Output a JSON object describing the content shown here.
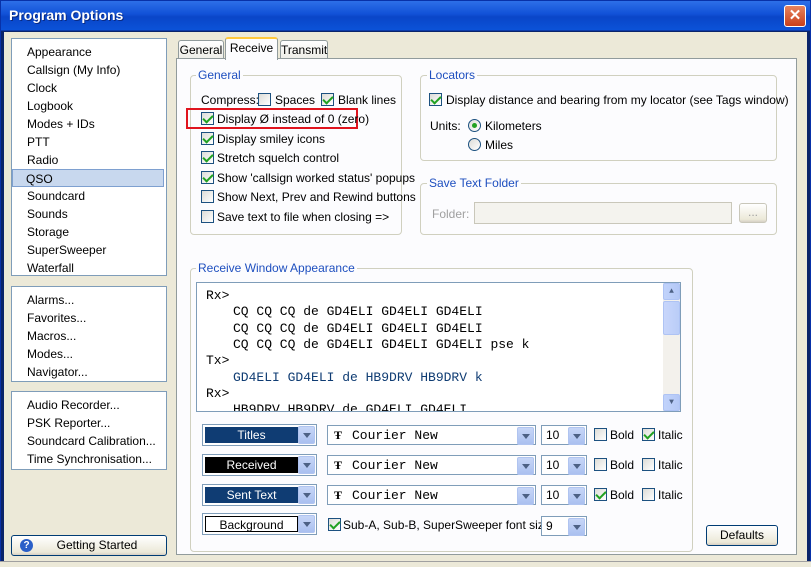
{
  "window": {
    "title": "Program Options"
  },
  "nav": {
    "group1": [
      "Appearance",
      "Callsign (My Info)",
      "Clock",
      "Logbook",
      "Modes + IDs",
      "PTT",
      "Radio",
      "QSO",
      "Soundcard",
      "Sounds",
      "Storage",
      "SuperSweeper",
      "Waterfall"
    ],
    "selected": "QSO",
    "group2": [
      "Alarms...",
      "Favorites...",
      "Macros...",
      "Modes...",
      "Navigator..."
    ],
    "group3": [
      "Audio Recorder...",
      "PSK Reporter...",
      "Soundcard Calibration...",
      "Time Synchronisation..."
    ],
    "getting_started": "Getting Started"
  },
  "tabs": [
    "General",
    "Receive",
    "Transmit"
  ],
  "active_tab": "Receive",
  "general": {
    "title": "General",
    "compress_label": "Compress:",
    "spaces": {
      "label": "Spaces",
      "checked": false
    },
    "blank_lines": {
      "label": "Blank lines",
      "checked": true
    },
    "options": [
      {
        "label": "Display Ø instead of 0 (zero)",
        "checked": true
      },
      {
        "label": "Display smiley icons",
        "checked": true
      },
      {
        "label": "Stretch squelch control",
        "checked": true
      },
      {
        "label": "Show 'callsign worked status' popups",
        "checked": true
      },
      {
        "label": "Show Next, Prev and Rewind buttons",
        "checked": false
      },
      {
        "label": "Save text to file when closing =>",
        "checked": false
      }
    ]
  },
  "locators": {
    "title": "Locators",
    "display_distance": {
      "label": "Display distance and bearing from my locator (see Tags window)",
      "checked": true
    },
    "units_label": "Units:",
    "units": [
      {
        "label": "Kilometers",
        "selected": true
      },
      {
        "label": "Miles",
        "selected": false
      }
    ]
  },
  "save_text_folder": {
    "title": "Save Text Folder",
    "folder_label": "Folder:",
    "folder_value": "",
    "browse_label": "..."
  },
  "appearance": {
    "title": "Receive Window Appearance",
    "preview_lines": [
      {
        "text": "Rx>",
        "indent": false,
        "color": "#000000"
      },
      {
        "text": "CQ CQ CQ de GD4ELI GD4ELI GD4ELI",
        "indent": true,
        "color": "#000000"
      },
      {
        "text": "CQ CQ CQ de GD4ELI GD4ELI GD4ELI",
        "indent": true,
        "color": "#000000"
      },
      {
        "text": "CQ CQ CQ de GD4ELI GD4ELI GD4ELI pse k",
        "indent": true,
        "color": "#000000"
      },
      {
        "text": "Tx>",
        "indent": false,
        "color": "#000000"
      },
      {
        "text": "GD4ELI GD4ELI de HB9DRV HB9DRV k",
        "indent": true,
        "color": "#0f3c73"
      },
      {
        "text": "Rx>",
        "indent": false,
        "color": "#000000"
      },
      {
        "text": "HB9DRV HB9DRV de GD4ELI GD4ELI",
        "indent": true,
        "color": "#000000"
      }
    ],
    "rows": [
      {
        "name": "Titles",
        "bg": "#0f3c73",
        "font": "Courier New",
        "size": "10",
        "bold": false,
        "italic": true,
        "bold_label": "Bold",
        "italic_label": "Italic"
      },
      {
        "name": "Received",
        "bg": "#000000",
        "font": "Courier New",
        "size": "10",
        "bold": false,
        "italic": false,
        "bold_label": "Bold",
        "italic_label": "Italic"
      },
      {
        "name": "Sent Text",
        "bg": "#0f3c73",
        "font": "Courier New",
        "size": "10",
        "bold": true,
        "italic": false,
        "bold_label": "Bold",
        "italic_label": "Italic"
      }
    ],
    "background_label": "Background",
    "sub_font": {
      "label": "Sub-A, Sub-B, SuperSweeper font size",
      "checked": true,
      "size": "9"
    }
  },
  "defaults_label": "Defaults",
  "font_icon": "Ŧ",
  "colors": {
    "group_title": "#1e4fbf",
    "highlight": "#e0141e"
  }
}
